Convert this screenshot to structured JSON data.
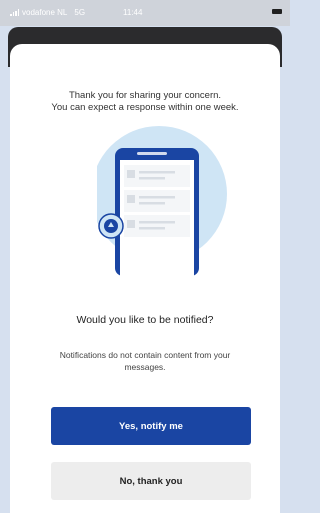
{
  "status_bar": {
    "carrier": "vodafone NL",
    "network": "5G",
    "time": "11:44"
  },
  "sheet": {
    "message_line1": "Thank you for sharing your concern.",
    "message_line2": "You can expect a response within one week.",
    "question": "Would you like to be notified?",
    "info": "Notifications do not contain content from your messages."
  },
  "actions": {
    "primary_label": "Yes, notify me",
    "secondary_label": "No, thank you"
  },
  "colors": {
    "primary_button": "#1a45a3",
    "secondary_button": "#ededed",
    "illustration_circle": "#cfe5f5",
    "phone": "#1a45a3"
  },
  "illustration": {
    "name": "phone-with-notification-illustration"
  }
}
